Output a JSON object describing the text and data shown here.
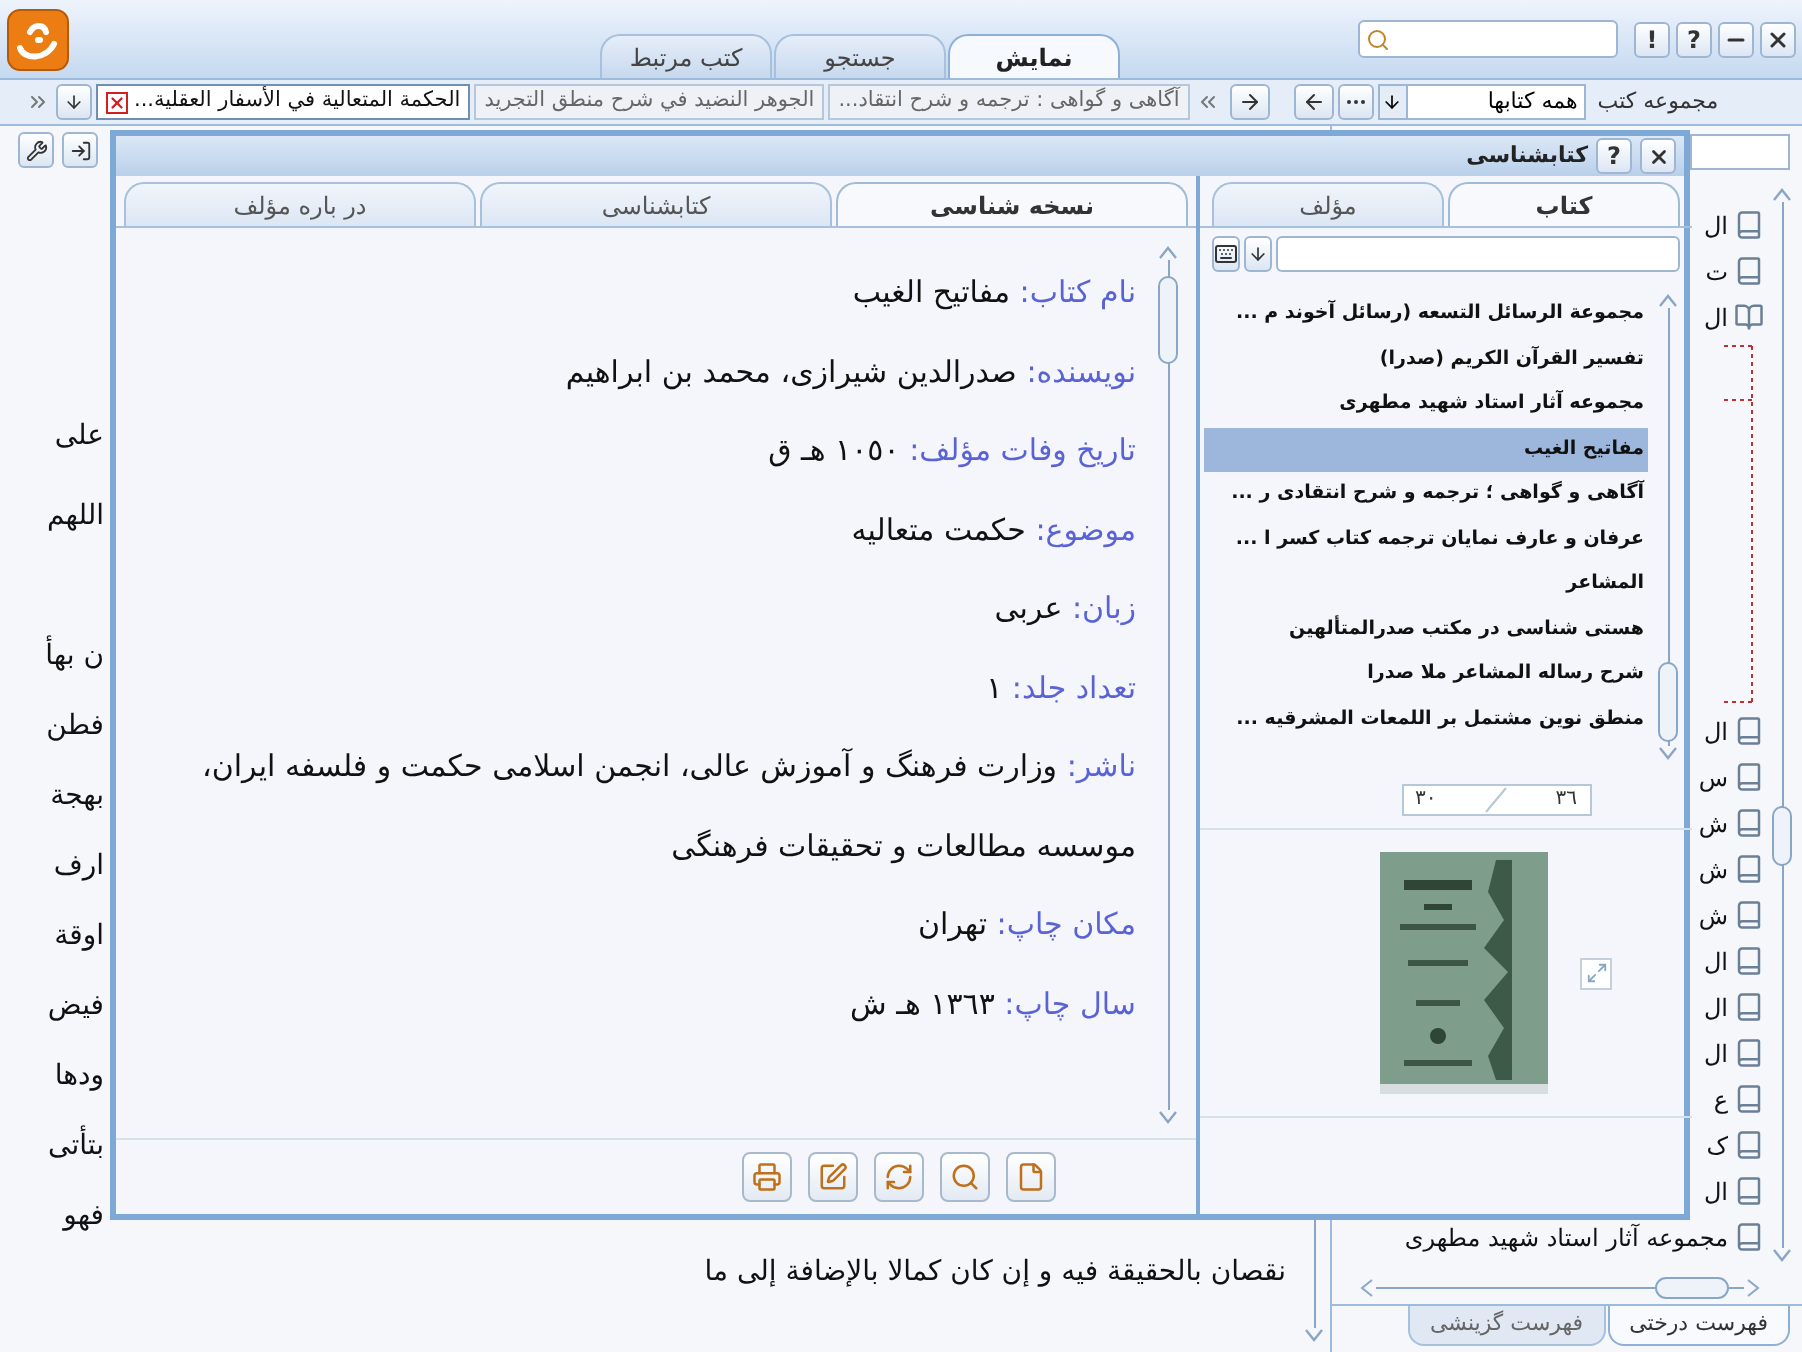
{
  "header": {
    "tabs": [
      {
        "label": "نمایش",
        "selected": true
      },
      {
        "label": "جستجو",
        "selected": false
      },
      {
        "label": "کتب مرتبط",
        "selected": false
      }
    ],
    "info_label": "!",
    "help_label": "?"
  },
  "toolbar": {
    "collection_label": "مجموعه کتب",
    "collection_value": "همه کتابها",
    "doc_tabs": [
      {
        "label": "آگاهی و گواهی : ترجمه و شرح انتقاد...",
        "selected": false
      },
      {
        "label": "الجوهر النضيد في شرح منطق التجريد",
        "selected": false
      },
      {
        "label": "الحكمة المتعالية في الأسفار العقلية...",
        "selected": true
      }
    ]
  },
  "reading_pane": {
    "fragments": [
      {
        "text": "على",
        "gap_before": false
      },
      {
        "text": "اللهم",
        "gap_before": false
      },
      {
        "text": "ن بهأ",
        "gap_before": true
      },
      {
        "text": "فطن",
        "gap_before": false
      },
      {
        "text": "بهجة",
        "gap_before": false
      },
      {
        "text": "ارف",
        "gap_before": false
      },
      {
        "text": "اوقة",
        "gap_before": false
      },
      {
        "text": "فيض",
        "gap_before": false
      },
      {
        "text": "ودها",
        "gap_before": false
      },
      {
        "text": "بتأتى",
        "gap_before": false
      },
      {
        "text": "فهو",
        "gap_before": false
      }
    ],
    "last_line": "نقصان بالحقيقة فيه و إن كان كمالا بالإضافة إلى ما"
  },
  "tree": {
    "top_rows": [
      {
        "kind": "closed",
        "text": "ال"
      },
      {
        "kind": "closed",
        "text": "ت"
      },
      {
        "kind": "open",
        "text": "ال"
      }
    ],
    "bottom_rows": [
      {
        "kind": "closed",
        "text": "ال"
      },
      {
        "kind": "closed",
        "text": "س"
      },
      {
        "kind": "closed",
        "text": "ش"
      },
      {
        "kind": "closed",
        "text": "ش"
      },
      {
        "kind": "closed",
        "text": "ش"
      },
      {
        "kind": "closed",
        "text": "ال"
      },
      {
        "kind": "closed",
        "text": "ال"
      },
      {
        "kind": "closed",
        "text": "ال"
      },
      {
        "kind": "closed",
        "text": "ع"
      },
      {
        "kind": "closed",
        "text": "ک"
      },
      {
        "kind": "closed",
        "text": "ال"
      },
      {
        "kind": "closed",
        "text": "مجموعه آثار استاد شهید مطهری"
      }
    ],
    "tabs": [
      {
        "label": "فهرست درختی",
        "selected": true
      },
      {
        "label": "فهرست گزینشی",
        "selected": false
      }
    ]
  },
  "dialog": {
    "title": "کتابشناسی",
    "help_label": "?",
    "side_tabs": [
      {
        "label": "کتاب",
        "selected": true
      },
      {
        "label": "مؤلف",
        "selected": false
      }
    ],
    "book_list": [
      {
        "title": "مجموعة الرسائل التسعه (رسائل آخوند م ...",
        "selected": false
      },
      {
        "title": "تفسير القرآن الكريم (صدرا)",
        "selected": false
      },
      {
        "title": "مجموعه آثار استاد شهيد مطهرى",
        "selected": false
      },
      {
        "title": "مفاتيح الغيب",
        "selected": true
      },
      {
        "title": "آگاهى و گواهى ؛ ترجمه و شرح انتقادى ر ...",
        "selected": false
      },
      {
        "title": "عرفان و عارف نمايان ترجمه كتاب كسر ا ...",
        "selected": false
      },
      {
        "title": "المشاعر",
        "selected": false
      },
      {
        "title": "هستى شناسى در مكتب صدرالمتألهين",
        "selected": false
      },
      {
        "title": "شرح رساله المشاعر ملا صدرا",
        "selected": false
      },
      {
        "title": "منطق نوين مشتمل بر اللمعات المشرقيه ...",
        "selected": false
      }
    ],
    "pager": [
      "٣٦",
      "٣٠"
    ],
    "cover": {
      "kind": "picture"
    },
    "detail_tabs": [
      {
        "label": "نسخه شناسی",
        "selected": true
      },
      {
        "label": "کتابشناسی",
        "selected": false
      },
      {
        "label": "در باره مؤلف",
        "selected": false
      }
    ],
    "fields": [
      {
        "label": "نام کتاب:",
        "value": "مفاتيح الغيب"
      },
      {
        "label": "نویسنده:",
        "value": "صدرالدين شيرازى، محمد بن ابراهيم"
      },
      {
        "label": "تاریخ وفات مؤلف:",
        "value": "١٠٥٠ هـ ق"
      },
      {
        "label": "موضوع:",
        "value": "حکمت متعاليه"
      },
      {
        "label": "زبان:",
        "value": "عربى"
      },
      {
        "label": "تعداد جلد:",
        "value": "١"
      },
      {
        "label": "ناشر:",
        "value": "وزارت فرهنگ و آموزش عالى، انجمن اسلامى حکمت و فلسفه ايران، موسسه مطالعات و تحقيقات فرهنگى"
      },
      {
        "label": "مکان چاپ:",
        "value": "تهران"
      },
      {
        "label": "سال چاپ:",
        "value": "١٣٦٣ هـ ش"
      }
    ],
    "actions": [
      {
        "kind": "print"
      },
      {
        "kind": "edit"
      },
      {
        "kind": "refresh"
      },
      {
        "kind": "search"
      },
      {
        "kind": "page"
      }
    ]
  }
}
